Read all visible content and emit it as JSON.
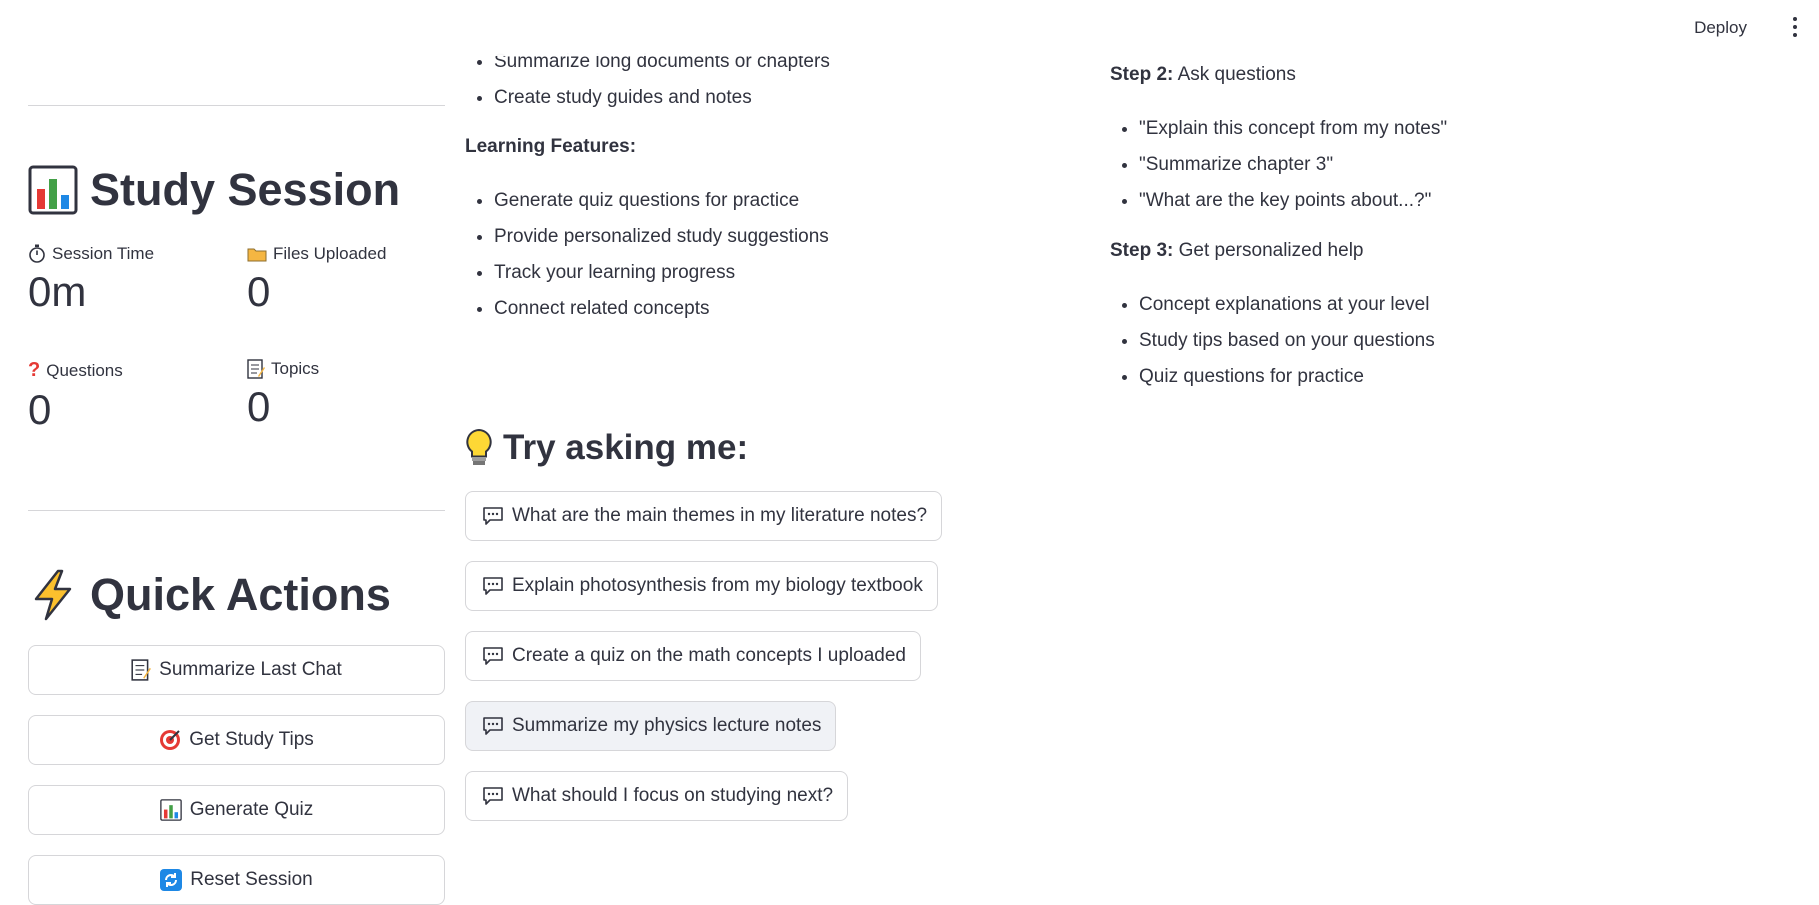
{
  "header": {
    "deploy_label": "Deploy"
  },
  "sidebar": {
    "study_session_title": "Study Session",
    "metrics": [
      {
        "label": "Session Time",
        "value": "0m"
      },
      {
        "label": "Files Uploaded",
        "value": "0"
      },
      {
        "label": "Questions",
        "value": "0"
      },
      {
        "label": "Topics",
        "value": "0"
      }
    ],
    "quick_actions_title": "Quick Actions",
    "buttons": [
      {
        "label": "Summarize Last Chat"
      },
      {
        "label": "Get Study Tips"
      },
      {
        "label": "Generate Quiz"
      },
      {
        "label": "Reset Session"
      }
    ]
  },
  "main": {
    "capabilities": {
      "cut_item": "Summarize long documents or chapters",
      "items_top": [
        "Create study guides and notes"
      ],
      "learning_heading": "Learning Features:",
      "learning_items": [
        "Generate quiz questions for practice",
        "Provide personalized study suggestions",
        "Track your learning progress",
        "Connect related concepts"
      ]
    },
    "try_asking_title": "Try asking me:",
    "suggestions": [
      "What are the main themes in my literature notes?",
      "Explain photosynthesis from my biology textbook",
      "Create a quiz on the math concepts I uploaded",
      "Summarize my physics lecture notes",
      "What should I focus on studying next?"
    ],
    "steps": {
      "step2_label": "Step 2:",
      "step2_text": " Ask questions",
      "step2_items": [
        "\"Explain this concept from my notes\"",
        "\"Summarize chapter 3\"",
        "\"What are the key points about...?\""
      ],
      "step3_label": "Step 3:",
      "step3_text": " Get personalized help",
      "step3_items": [
        "Concept explanations at your level",
        "Study tips based on your questions",
        "Quiz questions for practice"
      ]
    }
  },
  "colors": {
    "text": "#31333f",
    "border": "#d6d6d9",
    "hover_bg": "#f0f2f6"
  }
}
